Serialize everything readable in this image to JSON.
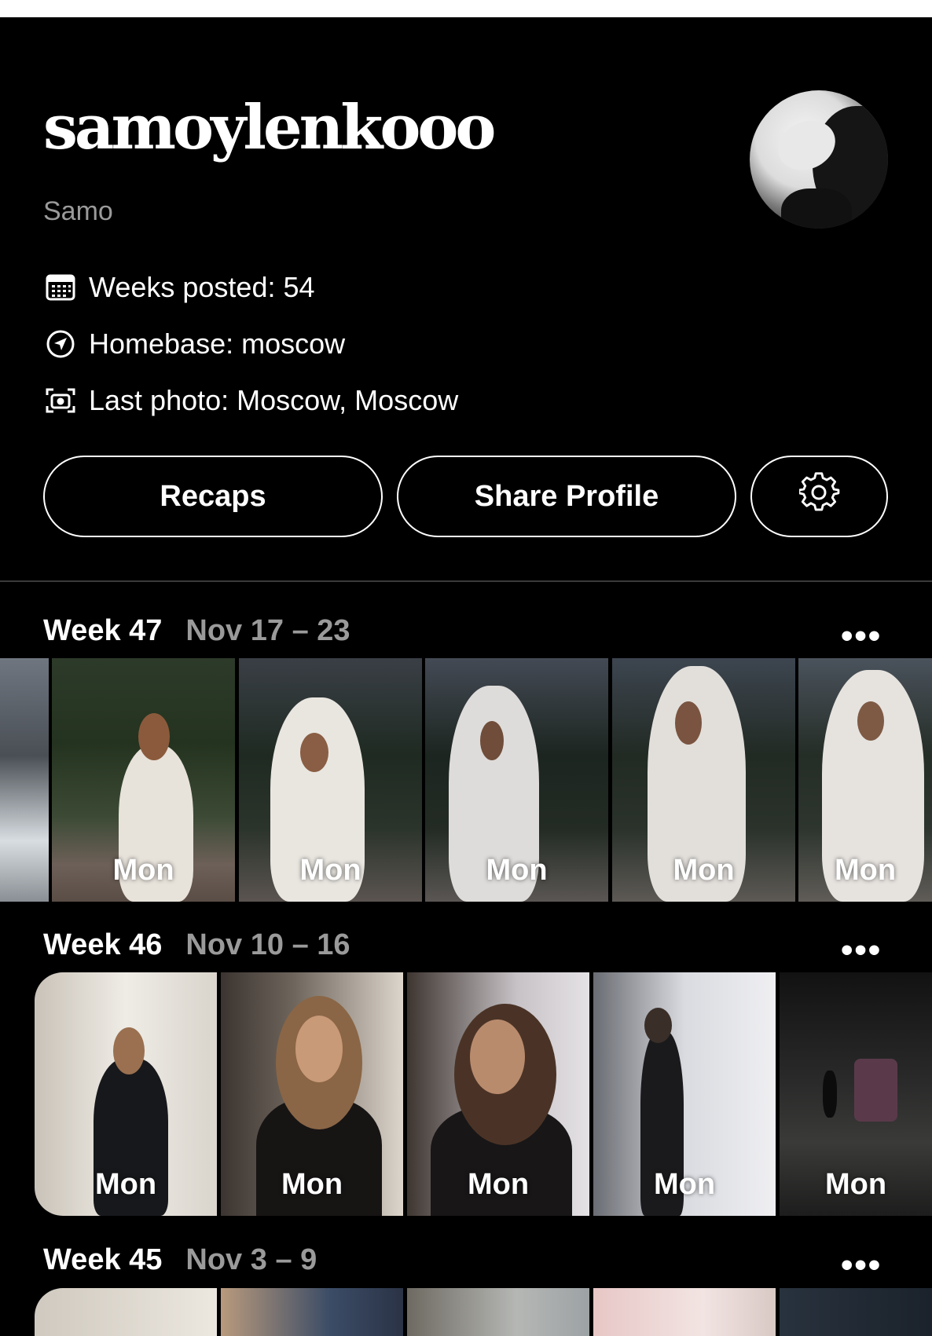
{
  "profile": {
    "username": "samoylenkooo",
    "display_name": "Samo",
    "weeks_posted": "Weeks posted: 54",
    "homebase": "Homebase: moscow",
    "last_photo": "Last photo: Moscow, Moscow"
  },
  "buttons": {
    "recaps": "Recaps",
    "share_profile": "Share Profile"
  },
  "icons": {
    "calendar": "calendar-icon",
    "location": "location-arrow-icon",
    "camera": "camera-icon",
    "settings": "gear-icon",
    "more": "more-dots-icon"
  },
  "weeks": [
    {
      "title": "Week 47",
      "range": "Nov 17 – 23",
      "more": "•••",
      "photos": [
        {
          "label": "Mon"
        },
        {
          "label": "Mon"
        },
        {
          "label": "Mon"
        },
        {
          "label": "Mon"
        },
        {
          "label": "Mon"
        }
      ]
    },
    {
      "title": "Week 46",
      "range": "Nov 10 – 16",
      "more": "•••",
      "photos": [
        {
          "label": "Mon"
        },
        {
          "label": "Mon"
        },
        {
          "label": "Mon"
        },
        {
          "label": "Mon"
        },
        {
          "label": "Mon"
        }
      ]
    },
    {
      "title": "Week 45",
      "range": "Nov 3 – 9",
      "more": "•••",
      "photos": []
    }
  ]
}
